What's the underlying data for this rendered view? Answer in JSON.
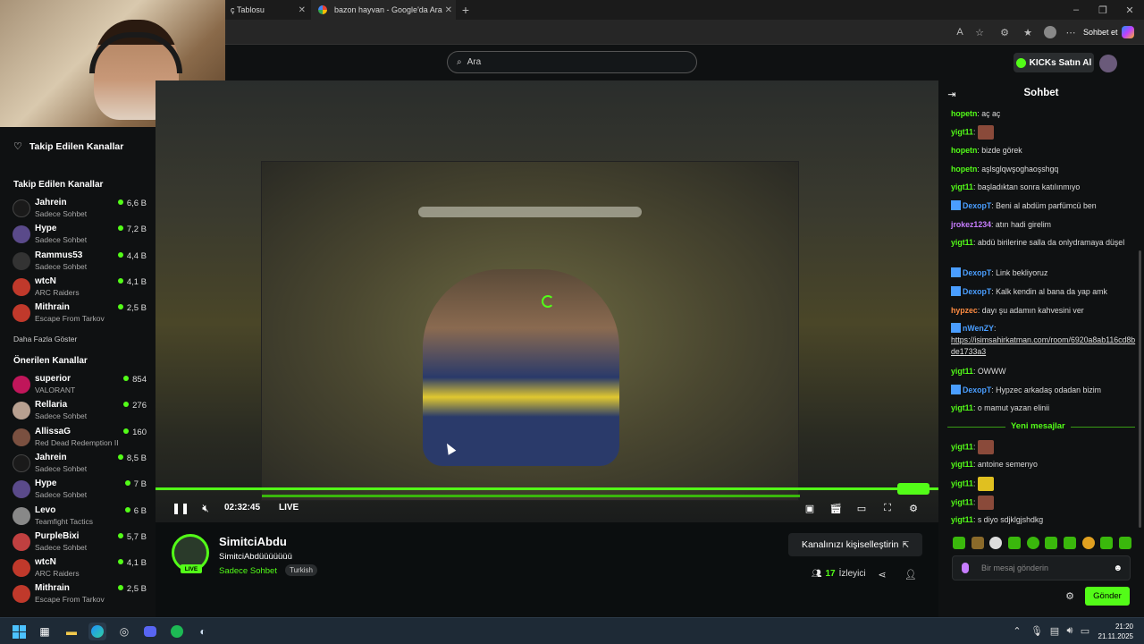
{
  "browser": {
    "tabs": [
      {
        "title": "ç Tablosu"
      },
      {
        "title": "bazon hayvan - Google'da Ara"
      }
    ],
    "sohbet_et": "Sohbet et"
  },
  "header": {
    "search_placeholder": "Ara",
    "buy_kicks": "KICKs Satın Al"
  },
  "sidebar": {
    "followed_title": "Takip Edilen Kanallar",
    "followed_section": "Takip Edilen Kanallar",
    "followed": [
      {
        "name": "Jahrein",
        "game": "Sadece Sohbet",
        "viewers": "6,6 B",
        "color": "#1a1a1a"
      },
      {
        "name": "Hype",
        "game": "Sadece Sohbet",
        "viewers": "7,2 B",
        "color": "#5a4a8a"
      },
      {
        "name": "Rammus53",
        "game": "Sadece Sohbet",
        "viewers": "4,4 B",
        "color": "#333"
      },
      {
        "name": "wtcN",
        "game": "ARC Raiders",
        "viewers": "4,1 B",
        "color": "#c0392b"
      },
      {
        "name": "Mithrain",
        "game": "Escape From Tarkov",
        "viewers": "2,5 B",
        "color": "#c0392b"
      }
    ],
    "show_more": "Daha Fazla Göster",
    "recommended_section": "Önerilen Kanallar",
    "recommended": [
      {
        "name": "superior",
        "game": "VALORANT",
        "viewers": "854",
        "color": "#c0165a"
      },
      {
        "name": "Rellaria",
        "game": "Sadece Sohbet",
        "viewers": "276",
        "color": "#b8a090"
      },
      {
        "name": "AllissaG",
        "game": "Red Dead Redemption II",
        "viewers": "160",
        "color": "#7a5040"
      },
      {
        "name": "Jahrein",
        "game": "Sadece Sohbet",
        "viewers": "8,5 B",
        "color": "#1a1a1a"
      },
      {
        "name": "Hype",
        "game": "Sadece Sohbet",
        "viewers": "7 B",
        "color": "#5a4a8a"
      },
      {
        "name": "Levo",
        "game": "Teamfight Tactics",
        "viewers": "6 B",
        "color": "#888"
      },
      {
        "name": "PurpleBixi",
        "game": "Sadece Sohbet",
        "viewers": "5,7 B",
        "color": "#c04040"
      },
      {
        "name": "wtcN",
        "game": "ARC Raiders",
        "viewers": "4,1 B",
        "color": "#c0392b"
      },
      {
        "name": "Mithrain",
        "game": "Escape From Tarkov",
        "viewers": "2,5 B",
        "color": "#c0392b"
      }
    ]
  },
  "player": {
    "time": "02:32:45",
    "live": "LIVE"
  },
  "channel": {
    "name": "SimitciAbdu",
    "title": "SimitciAbdüüüüüüü",
    "category": "Sadece Sohbet",
    "language": "Turkish",
    "live_badge": "LIVE",
    "customize": "Kanalınızı kişiselleştirin",
    "viewers_count": "17",
    "viewers_label": "İzleyici"
  },
  "chat": {
    "title": "Sohbet",
    "messages": [
      {
        "user": "hopetn",
        "color": "#53fc18",
        "text": "aç aç"
      },
      {
        "user": "yigt11",
        "color": "#53fc18",
        "text": "",
        "emote": true
      },
      {
        "user": "hopetn",
        "color": "#53fc18",
        "text": "bizde görek"
      },
      {
        "user": "hopetn",
        "color": "#53fc18",
        "text": "aşlsglqwşoghaoşshgq"
      },
      {
        "user": "yigt11",
        "color": "#53fc18",
        "text": "başladıktan sonra katılınmıyo"
      },
      {
        "user": "DexopT",
        "color": "#4a9eff",
        "text": "Beni al abdüm parfümcü ben"
      },
      {
        "user": "jrokez1234",
        "color": "#c77dff",
        "text": "atın hadi girelim"
      },
      {
        "user": "yigt11",
        "color": "#53fc18",
        "text": "abdü birilerine salla da onlydramaya düşel"
      },
      {
        "user": "DexopT",
        "color": "#4a9eff",
        "text": "Link bekliyoruz"
      },
      {
        "user": "DexopT",
        "color": "#4a9eff",
        "text": "Kalk kendin al bana da yap amk"
      },
      {
        "user": "hypzec",
        "color": "#ff8c42",
        "text": "dayı şu adamın kahvesini ver"
      },
      {
        "user": "nWenZY",
        "color": "#4a9eff",
        "text": "https://isimsahirkatman.com/room/6920a8ab116cd8bde1733a3"
      },
      {
        "user": "yigt11",
        "color": "#53fc18",
        "text": "OWWW"
      },
      {
        "user": "DexopT",
        "color": "#4a9eff",
        "text": "Hypzec arkadaş odadan bizim"
      },
      {
        "user": "yigt11",
        "color": "#53fc18",
        "text": "o mamut yazan elinii"
      }
    ],
    "new_messages": "Yeni mesajlar",
    "new": [
      {
        "user": "yigt11",
        "color": "#53fc18",
        "text": "",
        "emote": true
      },
      {
        "user": "yigt11",
        "color": "#53fc18",
        "text": "antoine semenyo"
      },
      {
        "user": "yigt11",
        "color": "#53fc18",
        "text": "",
        "emote": true
      },
      {
        "user": "yigt11",
        "color": "#53fc18",
        "text": "",
        "emote": true
      },
      {
        "user": "yigt11",
        "color": "#53fc18",
        "text": "s diyo sdjklgjshdkg"
      }
    ],
    "input_placeholder": "Bir mesaj gönderin",
    "send": "Gönder"
  },
  "taskbar": {
    "time": "21:20",
    "date": "21.11.2025"
  }
}
